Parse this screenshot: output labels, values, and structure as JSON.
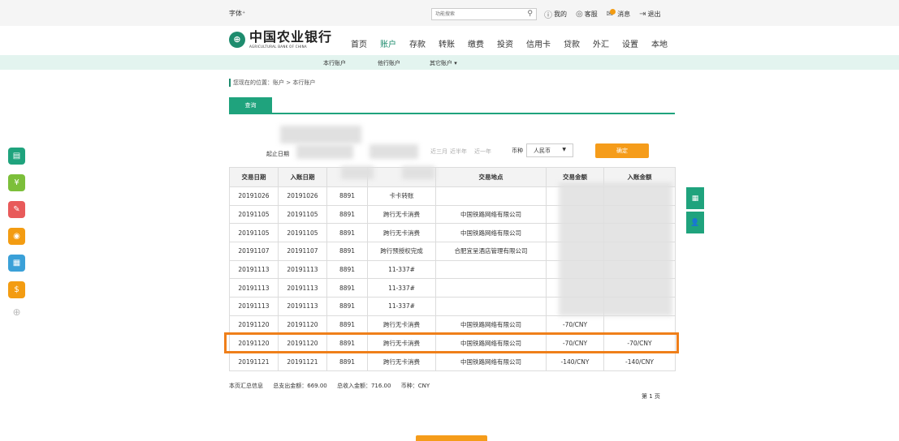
{
  "header": {
    "font_size_label": "字体⁺",
    "search_placeholder": "功能搜索",
    "links": [
      "我的",
      "客服",
      "消息",
      "退出"
    ]
  },
  "logo": {
    "cn": "中国农业银行",
    "en": "AGRICULTURAL BANK OF CHINA"
  },
  "nav": [
    "首页",
    "账户",
    "存款",
    "转账",
    "缴费",
    "投资",
    "信用卡",
    "贷款",
    "外汇",
    "设置",
    "本地"
  ],
  "subnav": [
    "本行账户",
    "他行账户",
    "其它账户 ▾"
  ],
  "breadcrumb": "您现在的位置：账户 > 本行账户",
  "tab": "查询",
  "filter": {
    "date_label": "起止日期",
    "quick": [
      "近三月",
      "近半年",
      "近一年"
    ],
    "currency_label": "币种",
    "currency_value": "人民币",
    "confirm": "确定"
  },
  "table": {
    "headers": [
      "交易日期",
      "入账日期",
      "卡号",
      "交易用途",
      "交易地点",
      "交易金额",
      "入账金额"
    ],
    "rows": [
      [
        "20191026",
        "20191026",
        "8891",
        "卡卡转账",
        "",
        "",
        ""
      ],
      [
        "20191105",
        "20191105",
        "8891",
        "跨行无卡消费",
        "中国铁路网络有限公司",
        "",
        ""
      ],
      [
        "20191105",
        "20191105",
        "8891",
        "跨行无卡消费",
        "中国铁路网络有限公司",
        "",
        ""
      ],
      [
        "20191107",
        "20191107",
        "8891",
        "跨行预授权完成",
        "合肥宜呈酒店管理有限公司",
        "",
        ""
      ],
      [
        "20191113",
        "20191113",
        "8891",
        "11-337#",
        "",
        "",
        ""
      ],
      [
        "20191113",
        "20191113",
        "8891",
        "11-337#",
        "",
        "",
        ""
      ],
      [
        "20191113",
        "20191113",
        "8891",
        "11-337#",
        "",
        "",
        ""
      ],
      [
        "20191120",
        "20191120",
        "8891",
        "跨行无卡消费",
        "中国铁路网络有限公司",
        "-70/CNY",
        ""
      ],
      [
        "20191120",
        "20191120",
        "8891",
        "跨行无卡消费",
        "中国铁路网络有限公司",
        "-70/CNY",
        "-70/CNY"
      ],
      [
        "20191121",
        "20191121",
        "8891",
        "跨行无卡消费",
        "中国铁路网络有限公司",
        "-140/CNY",
        "-140/CNY"
      ]
    ]
  },
  "summary": {
    "label": "本页汇总信息",
    "expense": "总支出金额：669.00",
    "income": "总收入金额：716.00",
    "currency": "币种：CNY"
  },
  "pager": "第 1 页",
  "colors": {
    "brand": "#1e8c6e",
    "accent": "#f59c1a",
    "highlight": "#ef7f1a"
  },
  "side_icons": [
    "card-icon",
    "yuan-icon",
    "chart-icon",
    "coins-icon",
    "transfer-icon",
    "dollar-icon"
  ]
}
